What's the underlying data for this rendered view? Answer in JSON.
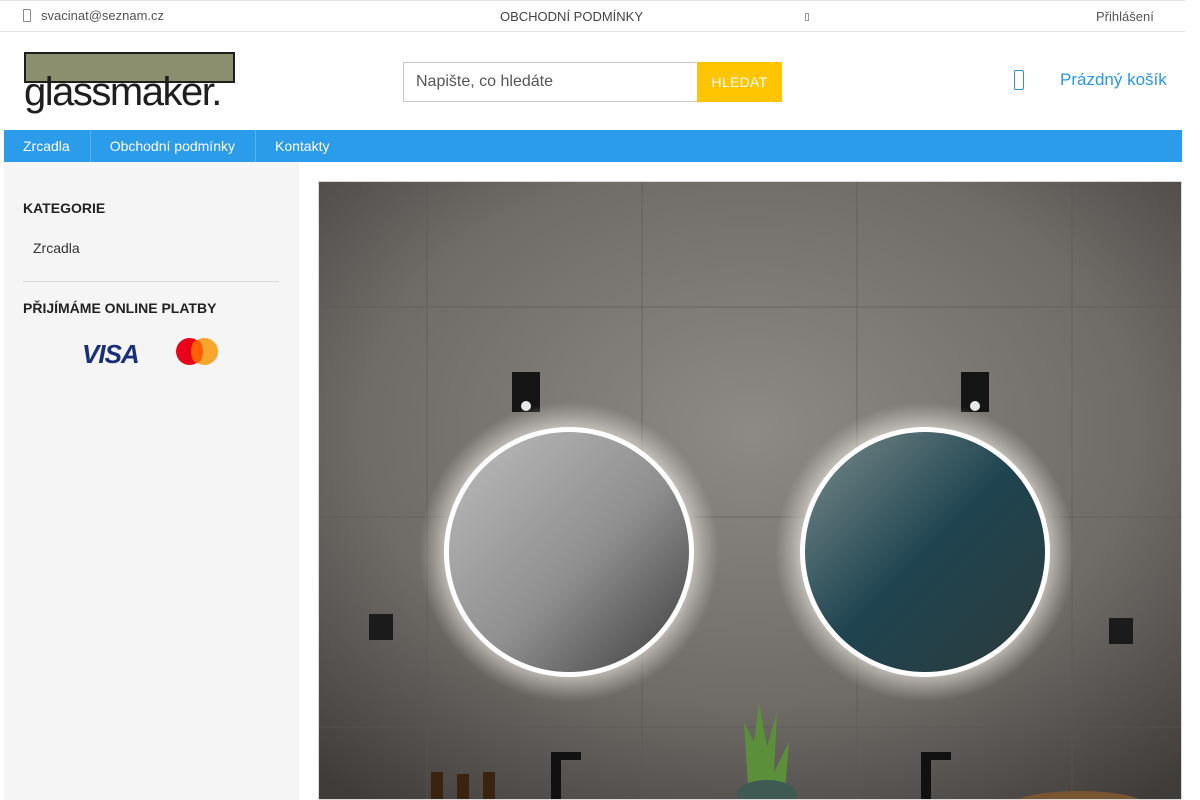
{
  "topbar": {
    "email": "svacinat@seznam.cz",
    "terms_link": "OBCHODNÍ PODMÍNKY",
    "login": "Přihlášení"
  },
  "header": {
    "logo_text": "glassmaker.",
    "search_placeholder": "Napište, co hledáte",
    "search_button": "HLEDAT",
    "cart_label": "Prázdný košík"
  },
  "nav": {
    "items": [
      {
        "label": "Zrcadla"
      },
      {
        "label": "Obchodní podmínky"
      },
      {
        "label": "Kontakty"
      }
    ]
  },
  "sidebar": {
    "categories_heading": "KATEGORIE",
    "categories": [
      {
        "label": "Zrcadla"
      }
    ],
    "payments_heading": "PŘIJÍMÁME ONLINE PLATBY",
    "visa_text": "VISA"
  },
  "colors": {
    "accent_blue": "#2b9cea",
    "search_button_yellow": "#ffc500",
    "logo_olive": "#8c8f6e"
  },
  "icons": {
    "mail": "envelope-icon",
    "cart": "cart-icon",
    "visa": "visa-logo",
    "mastercard": "mastercard-logo"
  }
}
